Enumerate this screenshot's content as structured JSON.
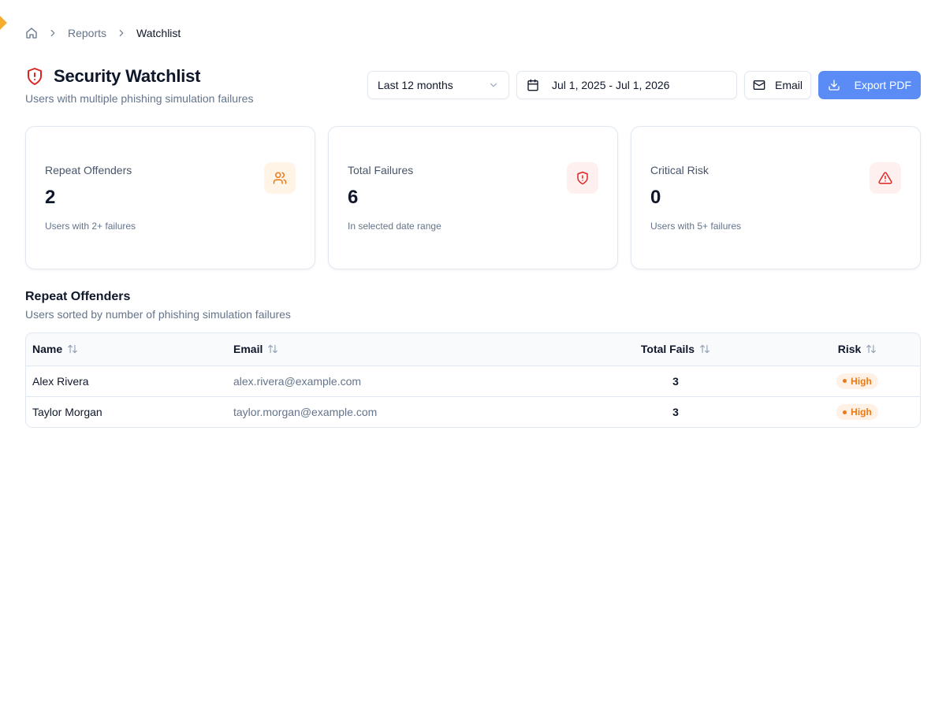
{
  "breadcrumb": {
    "home_icon": "home-icon",
    "items": [
      "Reports",
      "Watchlist"
    ]
  },
  "header": {
    "title": "Security Watchlist",
    "title_icon": "shield-alert-icon",
    "subtitle": "Users with multiple phishing simulation failures"
  },
  "toolbar": {
    "range_select": {
      "value": "Last 12 months",
      "icon": "chevron-down-icon"
    },
    "date_range": {
      "value": "Jul 1, 2025 - Jul 1, 2026",
      "icon": "calendar-icon"
    },
    "email_label": "Email",
    "email_icon": "mail-icon",
    "export_label": "Export PDF",
    "export_icon": "download-icon",
    "export_color": "#5b8cf5"
  },
  "stats": [
    {
      "label": "Repeat Offenders",
      "value": "2",
      "note": "Users with 2+ failures",
      "icon": "users-icon",
      "color": "#ea7a17"
    },
    {
      "label": "Total Failures",
      "value": "6",
      "note": "In selected date range",
      "icon": "shield-alert-icon",
      "color": "#dc2626"
    },
    {
      "label": "Critical Risk",
      "value": "0",
      "note": "Users with 5+ failures",
      "icon": "alert-triangle-icon",
      "color": "#dc2626"
    }
  ],
  "offenders": {
    "title": "Repeat Offenders",
    "subtitle": "Users sorted by number of phishing simulation failures",
    "columns": [
      "Name",
      "Email",
      "Total Fails",
      "Risk"
    ],
    "rows": [
      {
        "name": "Alex Rivera",
        "email": "alex.rivera@example.com",
        "fails": "3",
        "risk": "High"
      },
      {
        "name": "Taylor Morgan",
        "email": "taylor.morgan@example.com",
        "fails": "3",
        "risk": "High"
      }
    ],
    "risk_color": "#ea7a17"
  }
}
